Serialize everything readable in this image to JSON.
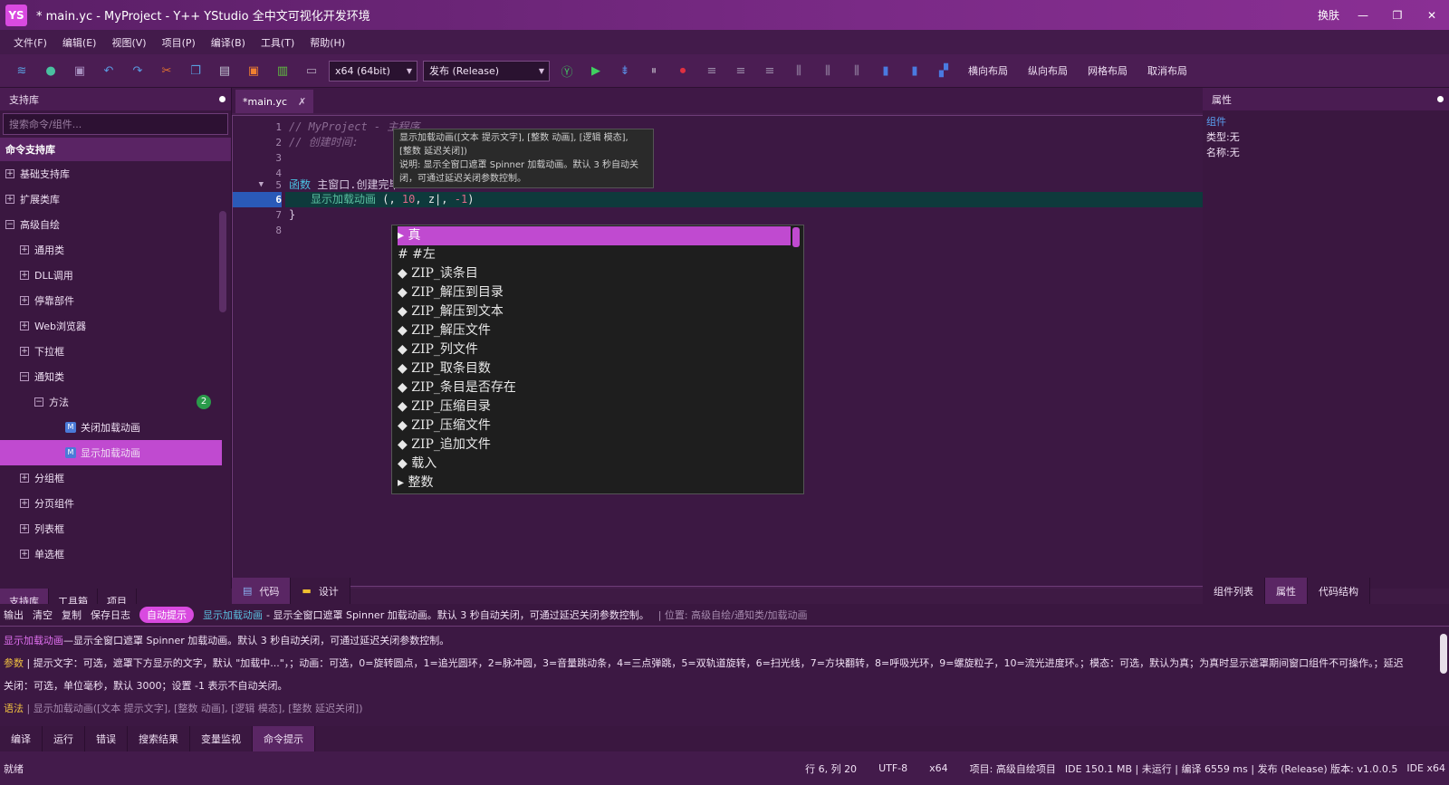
{
  "window": {
    "logo": "YS",
    "title": "* main.yc - MyProject - Y++ YStudio 全中文可视化开发环境",
    "skin": "换肤",
    "minimize": "—",
    "maximize": "❐",
    "close": "✕"
  },
  "menu": [
    "文件(F)",
    "编辑(E)",
    "视图(V)",
    "项目(P)",
    "编译(B)",
    "工具(T)",
    "帮助(H)"
  ],
  "toolbar": {
    "platform": "x64 (64bit)",
    "config": "发布 (Release)",
    "layouts": [
      "横向布局",
      "纵向布局",
      "网格布局",
      "取消布局"
    ]
  },
  "left_panel": {
    "title": "支持库",
    "search_placeholder": "搜索命令/组件...",
    "lib_header": "命令支持库",
    "tree": [
      {
        "label": "基础支持库",
        "pm": "+"
      },
      {
        "label": "扩展类库",
        "pm": "+"
      },
      {
        "label": "高级自绘",
        "pm": "−"
      },
      {
        "label": "通用类",
        "pm": "+"
      },
      {
        "label": "DLL调用",
        "pm": "+"
      },
      {
        "label": "停靠部件",
        "pm": "+"
      },
      {
        "label": "Web浏览器",
        "pm": "+"
      },
      {
        "label": "下拉框",
        "pm": "+"
      },
      {
        "label": "通知类",
        "pm": "−"
      },
      {
        "label": "方法",
        "pm": "−",
        "badge": "2"
      },
      {
        "label": "关闭加载动画",
        "icon": "M"
      },
      {
        "label": "显示加载动画",
        "icon": "M"
      },
      {
        "label": "分组框",
        "pm": "+"
      },
      {
        "label": "分页组件",
        "pm": "+"
      },
      {
        "label": "列表框",
        "pm": "+"
      },
      {
        "label": "单选框",
        "pm": "+"
      }
    ],
    "tabs": [
      "支持库",
      "工具箱",
      "项目"
    ]
  },
  "editor": {
    "file_tab": "*main.yc",
    "tab_close": "✗",
    "line_numbers": [
      "1",
      "2",
      "3",
      "4",
      "5",
      "6",
      "7",
      "8"
    ],
    "lines": {
      "l1": "// MyProject - 主程序",
      "l2": "// 创建时间:",
      "l5_kw": "函数",
      "l5_rest": " 主窗口.创建完毕",
      "l6_fn": "显示加载动画",
      "l6_a": " (, ",
      "l6_num1": "10",
      "l6_b": ", z|, ",
      "l6_num2": "-1",
      "l6_c": ")",
      "l7": "}"
    },
    "fold_marker": "▼",
    "tooltip": {
      "sig": "显示加载动画([文本 提示文字], [整数 动画], [逻辑 模态],",
      "sig2": "[整数 延迟关闭])",
      "desc": "说明: 显示全窗口遮罩 Spinner 加载动画。默认 3 秒自动关",
      "desc2": "闭，可通过延迟关闭参数控制。"
    },
    "autocomplete": [
      "▸ 真",
      "# #左",
      "◆ ZIP_读条目",
      "◆ ZIP_解压到目录",
      "◆ ZIP_解压到文本",
      "◆ ZIP_解压文件",
      "◆ ZIP_列文件",
      "◆ ZIP_取条目数",
      "◆ ZIP_条目是否存在",
      "◆ ZIP_压缩目录",
      "◆ ZIP_压缩文件",
      "◆ ZIP_追加文件",
      "◆ 载入",
      "▸ 整数"
    ],
    "tabs": [
      "代码",
      "设计"
    ]
  },
  "right_panel": {
    "title": "属性",
    "items": [
      "组件",
      "类型:无",
      "名称:无"
    ],
    "tabs": [
      "组件列表",
      "属性",
      "代码结构"
    ]
  },
  "output_bar": {
    "items": [
      "输出",
      "清空",
      "复制",
      "保存日志"
    ],
    "auto": "自动提示",
    "func": "显示加载动画",
    "desc": "- 显示全窗口遮罩 Spinner 加载动画。默认 3 秒自动关闭，可通过延迟关闭参数控制。",
    "loc": "| 位置: 高级自绘/通知类/加载动画"
  },
  "output": {
    "lead": "显示加载动画",
    "line1": "—显示全窗口遮罩 Spinner 加载动画。默认 3 秒自动关闭，可通过延迟关闭参数控制。",
    "param_label": "参数",
    "param_text": " | 提示文字：可选，遮罩下方显示的文字，默认 \"加载中...\"，；动画：可选，0=旋转圆点，1=追光圆环，2=脉冲圆，3=音量跳动条，4=三点弹跳，5=双轨道旋转，6=扫光线，7=方块翻转，8=呼吸光环，9=螺旋粒子，10=流光进度环。；模态：可选，默认为真；为真时显示遮罩期间窗口组件不可操作。；延迟关闭：可选，单位毫秒，默认 3000；设置 -1 表示不自动关闭。",
    "syn_label": "语法",
    "syn_text": " | 显示加载动画([文本 提示文字], [整数 动画], [逻辑 模态], [整数 延迟关闭])"
  },
  "bottom_tabs": [
    "编译",
    "运行",
    "错误",
    "搜索结果",
    "变量监视",
    "命令提示"
  ],
  "status": {
    "ready": "就绪",
    "pos": "行 6, 列 20",
    "enc": "UTF-8",
    "arch": "x64",
    "project": "项目: 高级自绘项目",
    "info": "IDE 150.1 MB | 未运行 | 编译 6559 ms | 发布 (Release) 版本: v1.0.0.5",
    "ide": "IDE x64"
  }
}
